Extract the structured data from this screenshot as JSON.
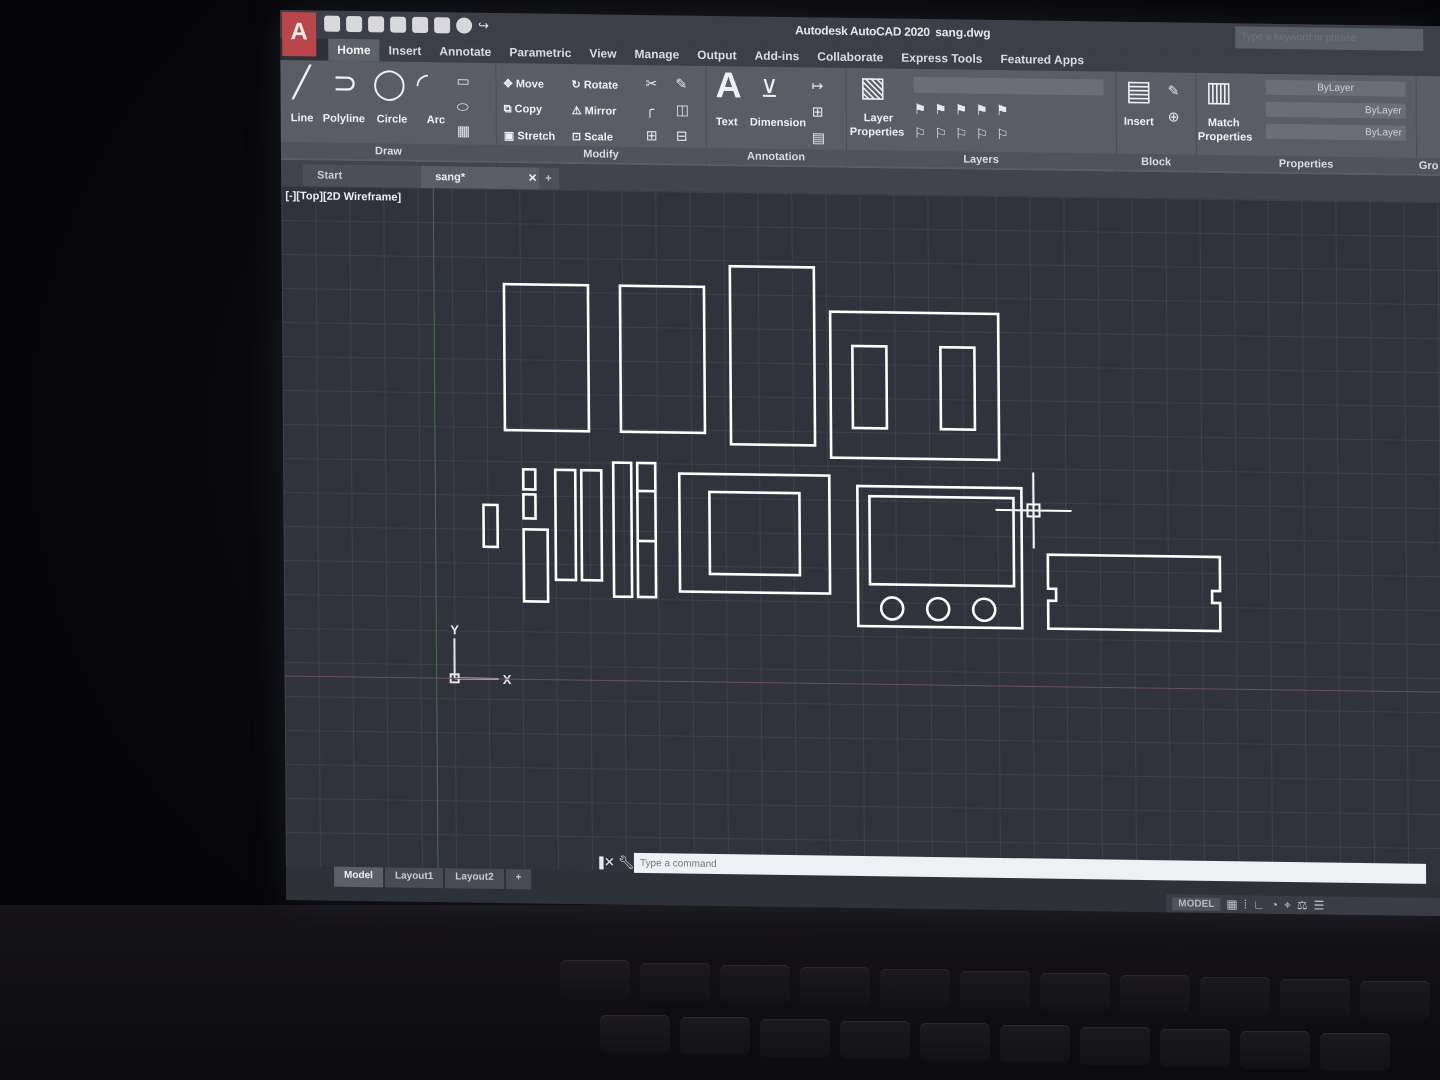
{
  "titlebar": {
    "app_title": "Autodesk AutoCAD 2020",
    "file_name": "sang.dwg",
    "search_placeholder": "Type a keyword or phrase",
    "logo_letter": "A"
  },
  "ribbon_tabs": [
    "Home",
    "Insert",
    "Annotate",
    "Parametric",
    "View",
    "Manage",
    "Output",
    "Add-ins",
    "Collaborate",
    "Express Tools",
    "Featured Apps"
  ],
  "ribbon": {
    "draw": {
      "label": "Draw",
      "tools": [
        "Line",
        "Polyline",
        "Circle",
        "Arc"
      ]
    },
    "modify": {
      "label": "Modify",
      "tools": [
        "Move",
        "Rotate",
        "Copy",
        "Mirror",
        "Stretch",
        "Scale"
      ]
    },
    "annotation": {
      "label": "Annotation",
      "tools": [
        "Text",
        "Dimension"
      ]
    },
    "layers": {
      "label": "Layers",
      "tools": [
        "Layer",
        "Properties"
      ]
    },
    "block": {
      "label": "Block",
      "tools": [
        "Insert"
      ]
    },
    "properties": {
      "label": "Properties",
      "tools": [
        "Match",
        "Properties"
      ],
      "bylayer": "ByLayer"
    },
    "groups_label": "Gro"
  },
  "doc_tabs": {
    "start": "Start",
    "current": "sang*"
  },
  "viewport": {
    "label": "[-][Top][2D Wireframe]",
    "ucs_x": "X",
    "ucs_y": "Y"
  },
  "command": {
    "placeholder": "Type a command"
  },
  "layout_tabs": [
    "Model",
    "Layout1",
    "Layout2"
  ],
  "status": {
    "mode": "MODEL"
  },
  "colors": {
    "background": "#30333b",
    "geometry": "#ffffff",
    "app_logo": "#b9464a"
  }
}
